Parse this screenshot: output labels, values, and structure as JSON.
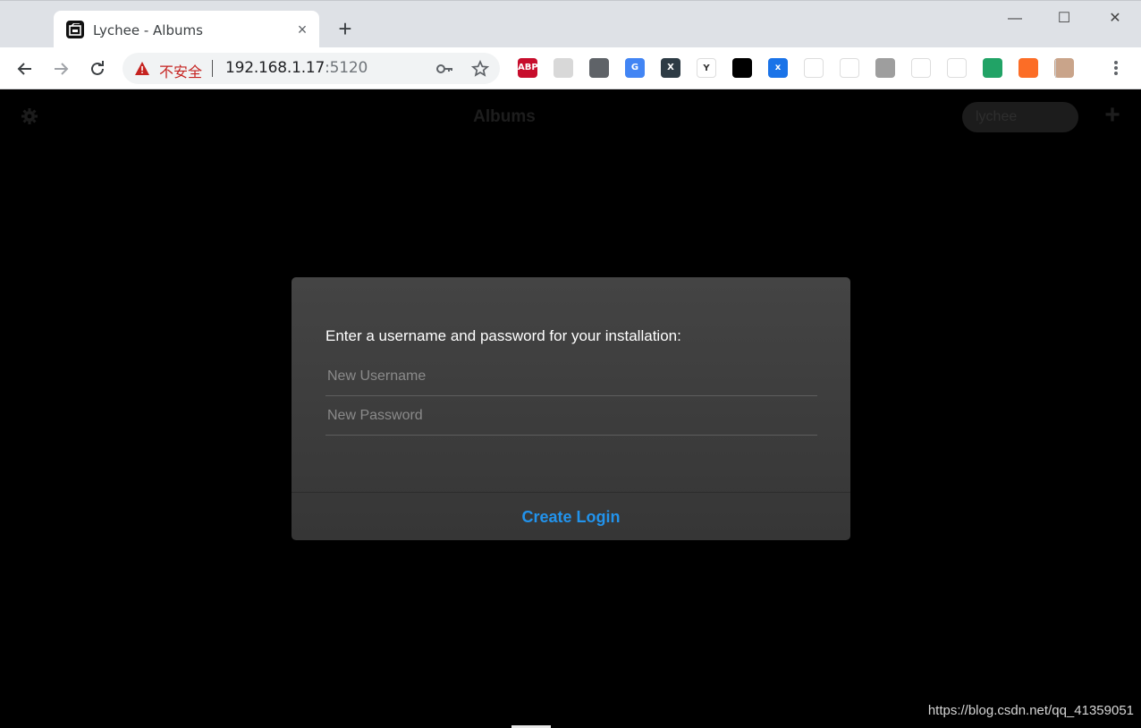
{
  "browser": {
    "tab": {
      "title": "Lychee - Albums",
      "close_glyph": "×"
    },
    "new_tab_glyph": "+",
    "window_controls": {
      "minimize": "—",
      "maximize": "☐",
      "close": "✕"
    },
    "address": {
      "security_label": "不安全",
      "url_host": "192.168.1.17",
      "url_port": ":5120"
    },
    "extensions": [
      {
        "name": "adblock-plus-icon",
        "label": "ABP",
        "color": "#c70d2c"
      },
      {
        "name": "screenshot-extension-icon",
        "label": "",
        "color": "#d8d8d8"
      },
      {
        "name": "pocket-icon",
        "label": "",
        "color": "#5f6368"
      },
      {
        "name": "google-translate-icon",
        "label": "G",
        "color": "#4285f4"
      },
      {
        "name": "xmind-icon",
        "label": "X",
        "color": "#2d3b45"
      },
      {
        "name": "yandex-icon",
        "label": "Y",
        "color": "#ffffff"
      },
      {
        "name": "tampermonkey-icon",
        "label": "",
        "color": "#000000"
      },
      {
        "name": "translate-x-icon",
        "label": "x",
        "color": "#1a73e8"
      },
      {
        "name": "pinwheel-icon",
        "label": "",
        "color": "#ffffff"
      },
      {
        "name": "sitemap-icon",
        "label": "",
        "color": "#ffffff"
      },
      {
        "name": "gray-box-icon",
        "label": "",
        "color": "#9e9e9e"
      },
      {
        "name": "octotree-icon",
        "label": "",
        "color": "#ffffff"
      },
      {
        "name": "github-icon",
        "label": "",
        "color": "#ffffff"
      },
      {
        "name": "green-gear-icon",
        "label": "",
        "color": "#21a366"
      },
      {
        "name": "gitlab-icon",
        "label": "",
        "color": "#fc6d26"
      },
      {
        "name": "profile-avatar-icon",
        "label": "",
        "color": "#c9a48a"
      }
    ]
  },
  "page": {
    "header": {
      "title": "Albums",
      "search_placeholder": "lychee"
    },
    "dialog": {
      "message": "Enter a username and password for your installation:",
      "username_placeholder": "New Username",
      "password_placeholder": "New Password",
      "button_label": "Create Login"
    },
    "watermark": "https://blog.csdn.net/qq_41359051"
  },
  "colors": {
    "accent": "#2293ec",
    "insecure": "#c5221f",
    "dialog_bg": "#404040"
  }
}
